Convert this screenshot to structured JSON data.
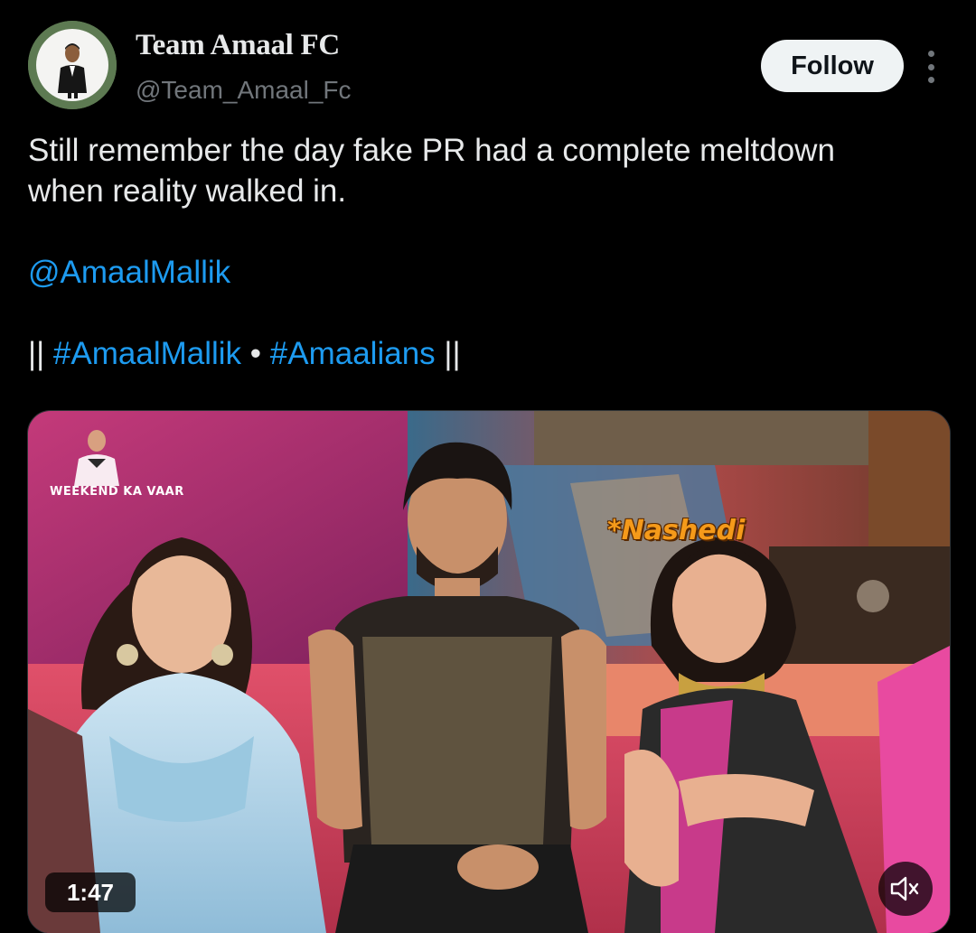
{
  "author": {
    "display_name": "Team Amaal FC",
    "handle": "@Team_Amaal_Fc",
    "avatar_icon": "profile-avatar"
  },
  "actions": {
    "follow_label": "Follow",
    "more_icon": "more-vertical-icon"
  },
  "tweet": {
    "text_line_1": "Still remember the day fake PR had a complete meltdown",
    "text_line_2": "when reality walked in.",
    "mention": "@AmaalMallik",
    "prefix_bars": "||",
    "hashtag_1": "#AmaalMallik",
    "separator": "•",
    "hashtag_2": "#Amaalians",
    "suffix_bars": "||"
  },
  "media": {
    "show_logo_text": "WEEKEND KA VAAR",
    "caption_overlay": "*Nashedi",
    "duration": "1:47",
    "mute_icon": "volume-muted-icon"
  },
  "colors": {
    "background": "#000000",
    "text": "#e7e9ea",
    "secondary_text": "#71767b",
    "link": "#1d9bf0",
    "follow_bg": "#eff3f4"
  }
}
